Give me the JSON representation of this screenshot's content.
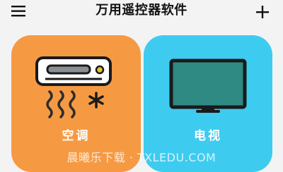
{
  "header": {
    "title": "万用遥控器软件",
    "menu_icon": "hamburger-menu-icon",
    "add_icon": "plus-icon"
  },
  "cards": [
    {
      "label": "空调",
      "icon": "air-conditioner-icon",
      "color": "#f59a43"
    },
    {
      "label": "电视",
      "icon": "television-icon",
      "color": "#3ecbf0"
    }
  ],
  "watermark": "晨曦乐下载 · TXLEDU.COM",
  "colors": {
    "background": "#f3f3f4",
    "text": "#111111",
    "ac_card": "#f59a43",
    "tv_card": "#3ecbf0",
    "icon_dark": "#1a1a1a",
    "tv_screen": "#2f8a83",
    "ac_panel": "#8a8f93",
    "ac_led": "#e4c62a",
    "ac_wind": "#2d2d2d"
  }
}
